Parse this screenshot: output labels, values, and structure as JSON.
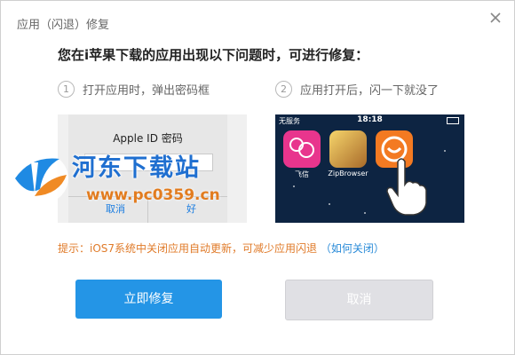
{
  "window": {
    "title": "应用（闪退）修复"
  },
  "heading": "您在i苹果下载的应用出现以下问题时，可进行修复：",
  "problems": [
    {
      "num": "1",
      "text": "打开应用时，弹出密码框"
    },
    {
      "num": "2",
      "text": "应用打开后，闪一下就没了"
    }
  ],
  "screenshot1": {
    "alert_title": "Apple ID 密码",
    "cancel": "取消",
    "ok": "好"
  },
  "screenshot2": {
    "carrier": "无服务",
    "time": "18:18",
    "apps": [
      {
        "label": "飞信",
        "color": "#e8358d"
      },
      {
        "label": "ZipBrowser",
        "color": "#d8a23a"
      },
      {
        "label": "",
        "color": "#f37a22"
      }
    ]
  },
  "tip": {
    "text": "提示：iOS7系统中关闭应用自动更新，可减少应用闪退",
    "link": "（如何关闭）"
  },
  "buttons": {
    "repair": "立即修复",
    "cancel": "取消"
  },
  "watermark": {
    "name": "河东下载站",
    "url": "www.pc0359.cn"
  },
  "colors": {
    "primary": "#2495e6",
    "tip": "#e07b2a",
    "link": "#2a8bd8"
  }
}
